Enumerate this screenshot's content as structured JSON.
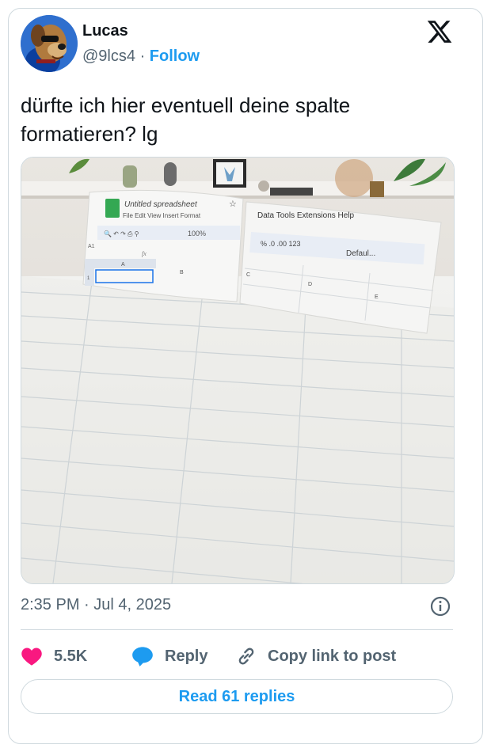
{
  "author": {
    "name": "Lucas",
    "handle": "@9lcs4",
    "separator": "·",
    "follow_label": "Follow"
  },
  "tweet": {
    "text": "dürfte ich hier eventuell deine spalte formatieren? lg"
  },
  "media": {
    "doc_title": "Untitled spreadsheet",
    "menu_left": [
      "File",
      "Edit",
      "View",
      "Insert",
      "Format"
    ],
    "menu_right": [
      "Data",
      "Tools",
      "Extensions",
      "Help"
    ],
    "zoom": "100%",
    "cell_ref": "A1",
    "fx": "fx",
    "font_select": "Defaul...",
    "format_buttons": [
      "%",
      ".0",
      ".00",
      "123"
    ],
    "columns": [
      "A",
      "B",
      "C",
      "D",
      "E"
    ],
    "row_number": "1"
  },
  "meta": {
    "time": "2:35 PM",
    "separator": "·",
    "date": "Jul 4, 2025"
  },
  "actions": {
    "likes": "5.5K",
    "reply_label": "Reply",
    "copy_label": "Copy link to post"
  },
  "read_replies": "Read 61 replies",
  "colors": {
    "accent": "#1d9bf0",
    "like": "#f91880",
    "muted": "#536471",
    "border": "#cfd9de"
  }
}
